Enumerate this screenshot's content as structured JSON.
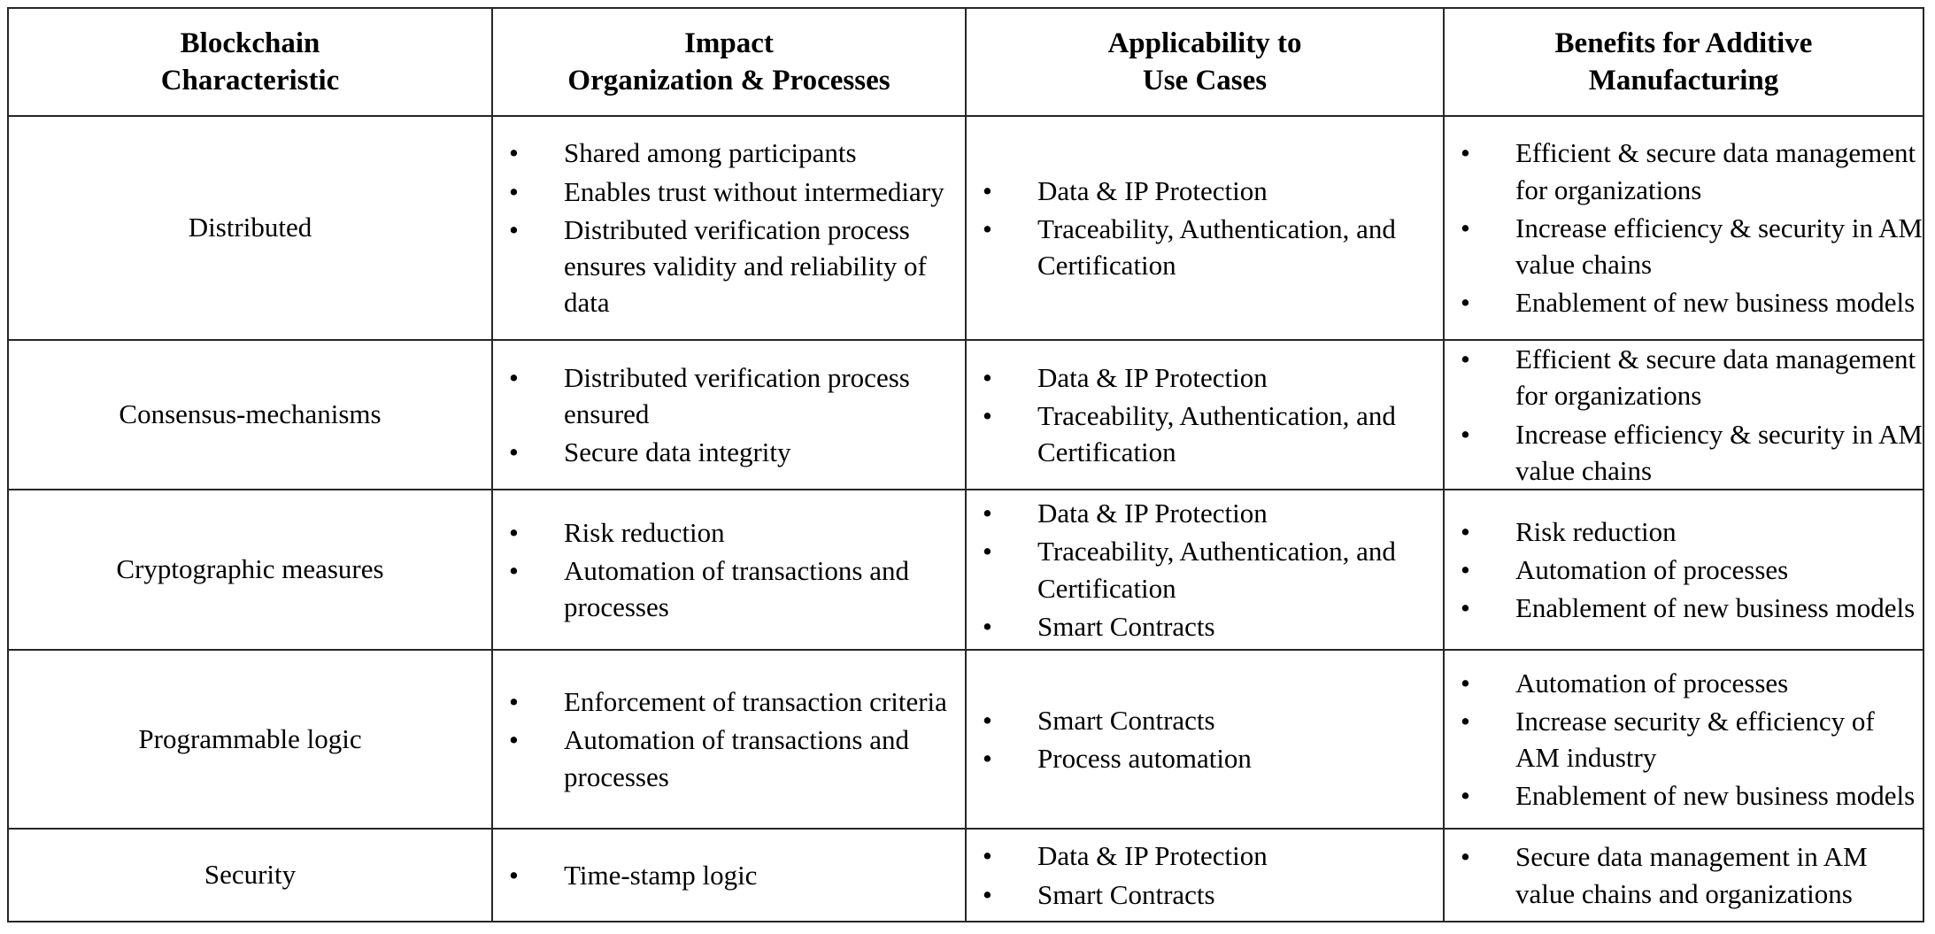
{
  "table": {
    "header_background": "#dce6f1",
    "border_color": "#262626",
    "columns": [
      {
        "id": "characteristic",
        "lines": [
          "Blockchain",
          "Characteristic"
        ]
      },
      {
        "id": "impact",
        "lines": [
          "Impact",
          "Organization & Processes"
        ]
      },
      {
        "id": "applicability",
        "lines": [
          "Applicability to",
          "Use Cases"
        ]
      },
      {
        "id": "benefits",
        "lines": [
          "Benefits for Additive",
          "Manufacturing"
        ]
      }
    ],
    "bullet_glyph": "•",
    "rows": [
      {
        "characteristic": "Distributed",
        "impact": [
          "Shared among participants",
          "Enables trust without intermediary",
          "Distributed verification process ensures validity and reliability of data"
        ],
        "applicability": [
          "Data & IP Protection",
          "Traceability, Authentication, and Certification"
        ],
        "benefits": [
          "Efficient & secure data management for organizations",
          "Increase efficiency & security in AM value chains",
          "Enablement of new business models"
        ]
      },
      {
        "characteristic": "Consensus-mechanisms",
        "impact": [
          "Distributed verification process ensured",
          "Secure data integrity"
        ],
        "applicability": [
          "Data & IP Protection",
          "Traceability, Authentication, and Certification"
        ],
        "benefits": [
          "Efficient & secure data management for organizations",
          "Increase efficiency & security in AM value chains"
        ]
      },
      {
        "characteristic": "Cryptographic measures",
        "impact": [
          "Risk reduction",
          "Automation of transactions and processes"
        ],
        "applicability": [
          "Data & IP Protection",
          "Traceability, Authentication, and Certification",
          "Smart Contracts"
        ],
        "benefits": [
          "Risk reduction",
          "Automation of processes",
          "Enablement of new business models"
        ]
      },
      {
        "characteristic": "Programmable logic",
        "impact": [
          "Enforcement of transaction criteria",
          "Automation of transactions and processes"
        ],
        "applicability": [
          "Smart Contracts",
          "Process automation"
        ],
        "benefits": [
          "Automation of processes",
          "Increase security & efficiency of AM industry",
          "Enablement of new business models"
        ]
      },
      {
        "characteristic": "Security",
        "impact": [
          "Time-stamp logic"
        ],
        "applicability": [
          "Data & IP Protection",
          "Smart Contracts"
        ],
        "benefits": [
          "Secure data management in AM value chains and organizations"
        ]
      }
    ]
  }
}
